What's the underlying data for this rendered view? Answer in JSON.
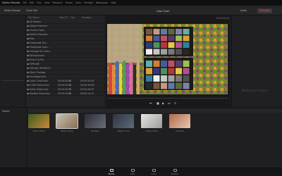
{
  "menu": [
    "DaVinci Resolve",
    "File",
    "Edit",
    "Trim",
    "View",
    "Playback",
    "Fusion",
    "Color",
    "Fairlight",
    "Workspace",
    "Help"
  ],
  "toolbar": {
    "media_storage": "Media Storage",
    "clone_tool": "Clone Tool",
    "viewer_title": "Color Chart",
    "audio": "Audio",
    "metadata": "Metadata",
    "clip_label": "Clip"
  },
  "bins": [
    {
      "name": "All Movies",
      "v1": "",
      "v2": "",
      "v3": ""
    },
    {
      "name": "Adobe Premiere",
      "v1": "",
      "v2": "",
      "v3": ""
    },
    {
      "name": "Cinema Tools",
      "v1": "",
      "v2": "",
      "v3": ""
    },
    {
      "name": "DaVinci Resolve",
      "v1": "",
      "v2": "",
      "v3": ""
    },
    {
      "name": "Misc",
      "v1": "",
      "v2": "",
      "v3": ""
    },
    {
      "name": "Pixelgrade Ext...",
      "v1": "",
      "v2": "",
      "v3": ""
    },
    {
      "name": "Pixelgrade Spec...",
      "v1": "",
      "v2": "",
      "v3": ""
    },
    {
      "name": "Footage For Color...",
      "v1": "",
      "v2": "",
      "v3": ""
    },
    {
      "name": "Backgrounds",
      "v1": "",
      "v2": "",
      "v3": ""
    },
    {
      "name": "Final Cut Pro",
      "v1": "",
      "v2": "",
      "v3": ""
    },
    {
      "name": "PIPELINE",
      "v1": "",
      "v2": "",
      "v3": ""
    },
    {
      "name": "SPECIAL PROJECTS",
      "v1": "",
      "v2": "",
      "v3": ""
    },
    {
      "name": "Stock Footage",
      "v1": "",
      "v2": "",
      "v3": ""
    },
    {
      "name": "Uncategorized",
      "v1": "",
      "v2": "",
      "v3": ""
    },
    {
      "name": "Color Chart.mov",
      "v1": "00:00:00:00",
      "v2": "0",
      "v3": "00:00:05:04"
    },
    {
      "name": "H.265 Demo.mov",
      "v1": "00:00:00:00",
      "v2": "0",
      "v3": "00:00:10:08"
    },
    {
      "name": "Hotel Lobby.mov",
      "v1": "00:00:00:00",
      "v2": "0",
      "v3": "00:00:08:02"
    },
    {
      "name": "Rooftop Party.mov",
      "v1": "00:00:00:00",
      "v2": "0",
      "v3": "00:00:14:17"
    }
  ],
  "headers": {
    "name": "File Name",
    "start": "Start TC",
    "fps": "Fps",
    "dur": "Duration"
  },
  "master_label": "Master",
  "inspector_hint": "Nothing to inspect",
  "thumbs": [
    {
      "label": "Color Chart",
      "c1": "#3b5a1f",
      "c2": "#c98b3a"
    },
    {
      "label": "Hotel Lobby",
      "c1": "#c7c3b8",
      "c2": "#8a6d4f"
    },
    {
      "label": "Rooftop",
      "c1": "#2a2c35",
      "c2": "#6b6f7a"
    },
    {
      "label": "Night Drive",
      "c1": "#2e3540",
      "c2": "#5c6a7a"
    },
    {
      "label": "Lobby Wide",
      "c1": "#e8e6e0",
      "c2": "#9b9b9b"
    },
    {
      "label": "Portrait",
      "c1": "#b06a4a",
      "c2": "#e6c9b0"
    }
  ],
  "app_name": "DaVinci Resolve 12",
  "pages": [
    {
      "label": "Media",
      "active": true
    },
    {
      "label": "Edit",
      "active": false
    },
    {
      "label": "Color",
      "active": false
    },
    {
      "label": "Deliver",
      "active": false
    }
  ],
  "colors": {
    "accent": "#e05a44"
  }
}
